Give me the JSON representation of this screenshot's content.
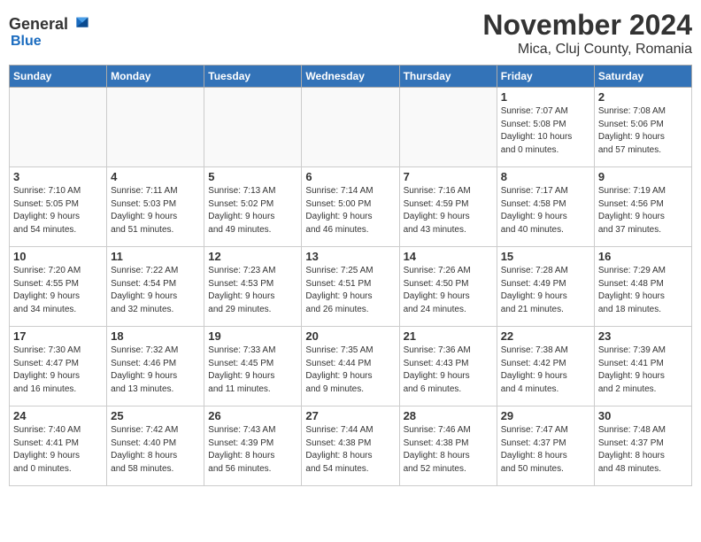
{
  "logo": {
    "general": "General",
    "blue": "Blue"
  },
  "title": "November 2024",
  "location": "Mica, Cluj County, Romania",
  "days_of_week": [
    "Sunday",
    "Monday",
    "Tuesday",
    "Wednesday",
    "Thursday",
    "Friday",
    "Saturday"
  ],
  "weeks": [
    [
      {
        "num": "",
        "info": "",
        "empty": true
      },
      {
        "num": "",
        "info": "",
        "empty": true
      },
      {
        "num": "",
        "info": "",
        "empty": true
      },
      {
        "num": "",
        "info": "",
        "empty": true
      },
      {
        "num": "",
        "info": "",
        "empty": true
      },
      {
        "num": "1",
        "info": "Sunrise: 7:07 AM\nSunset: 5:08 PM\nDaylight: 10 hours\nand 0 minutes.",
        "empty": false
      },
      {
        "num": "2",
        "info": "Sunrise: 7:08 AM\nSunset: 5:06 PM\nDaylight: 9 hours\nand 57 minutes.",
        "empty": false
      }
    ],
    [
      {
        "num": "3",
        "info": "Sunrise: 7:10 AM\nSunset: 5:05 PM\nDaylight: 9 hours\nand 54 minutes.",
        "empty": false
      },
      {
        "num": "4",
        "info": "Sunrise: 7:11 AM\nSunset: 5:03 PM\nDaylight: 9 hours\nand 51 minutes.",
        "empty": false
      },
      {
        "num": "5",
        "info": "Sunrise: 7:13 AM\nSunset: 5:02 PM\nDaylight: 9 hours\nand 49 minutes.",
        "empty": false
      },
      {
        "num": "6",
        "info": "Sunrise: 7:14 AM\nSunset: 5:00 PM\nDaylight: 9 hours\nand 46 minutes.",
        "empty": false
      },
      {
        "num": "7",
        "info": "Sunrise: 7:16 AM\nSunset: 4:59 PM\nDaylight: 9 hours\nand 43 minutes.",
        "empty": false
      },
      {
        "num": "8",
        "info": "Sunrise: 7:17 AM\nSunset: 4:58 PM\nDaylight: 9 hours\nand 40 minutes.",
        "empty": false
      },
      {
        "num": "9",
        "info": "Sunrise: 7:19 AM\nSunset: 4:56 PM\nDaylight: 9 hours\nand 37 minutes.",
        "empty": false
      }
    ],
    [
      {
        "num": "10",
        "info": "Sunrise: 7:20 AM\nSunset: 4:55 PM\nDaylight: 9 hours\nand 34 minutes.",
        "empty": false
      },
      {
        "num": "11",
        "info": "Sunrise: 7:22 AM\nSunset: 4:54 PM\nDaylight: 9 hours\nand 32 minutes.",
        "empty": false
      },
      {
        "num": "12",
        "info": "Sunrise: 7:23 AM\nSunset: 4:53 PM\nDaylight: 9 hours\nand 29 minutes.",
        "empty": false
      },
      {
        "num": "13",
        "info": "Sunrise: 7:25 AM\nSunset: 4:51 PM\nDaylight: 9 hours\nand 26 minutes.",
        "empty": false
      },
      {
        "num": "14",
        "info": "Sunrise: 7:26 AM\nSunset: 4:50 PM\nDaylight: 9 hours\nand 24 minutes.",
        "empty": false
      },
      {
        "num": "15",
        "info": "Sunrise: 7:28 AM\nSunset: 4:49 PM\nDaylight: 9 hours\nand 21 minutes.",
        "empty": false
      },
      {
        "num": "16",
        "info": "Sunrise: 7:29 AM\nSunset: 4:48 PM\nDaylight: 9 hours\nand 18 minutes.",
        "empty": false
      }
    ],
    [
      {
        "num": "17",
        "info": "Sunrise: 7:30 AM\nSunset: 4:47 PM\nDaylight: 9 hours\nand 16 minutes.",
        "empty": false
      },
      {
        "num": "18",
        "info": "Sunrise: 7:32 AM\nSunset: 4:46 PM\nDaylight: 9 hours\nand 13 minutes.",
        "empty": false
      },
      {
        "num": "19",
        "info": "Sunrise: 7:33 AM\nSunset: 4:45 PM\nDaylight: 9 hours\nand 11 minutes.",
        "empty": false
      },
      {
        "num": "20",
        "info": "Sunrise: 7:35 AM\nSunset: 4:44 PM\nDaylight: 9 hours\nand 9 minutes.",
        "empty": false
      },
      {
        "num": "21",
        "info": "Sunrise: 7:36 AM\nSunset: 4:43 PM\nDaylight: 9 hours\nand 6 minutes.",
        "empty": false
      },
      {
        "num": "22",
        "info": "Sunrise: 7:38 AM\nSunset: 4:42 PM\nDaylight: 9 hours\nand 4 minutes.",
        "empty": false
      },
      {
        "num": "23",
        "info": "Sunrise: 7:39 AM\nSunset: 4:41 PM\nDaylight: 9 hours\nand 2 minutes.",
        "empty": false
      }
    ],
    [
      {
        "num": "24",
        "info": "Sunrise: 7:40 AM\nSunset: 4:41 PM\nDaylight: 9 hours\nand 0 minutes.",
        "empty": false
      },
      {
        "num": "25",
        "info": "Sunrise: 7:42 AM\nSunset: 4:40 PM\nDaylight: 8 hours\nand 58 minutes.",
        "empty": false
      },
      {
        "num": "26",
        "info": "Sunrise: 7:43 AM\nSunset: 4:39 PM\nDaylight: 8 hours\nand 56 minutes.",
        "empty": false
      },
      {
        "num": "27",
        "info": "Sunrise: 7:44 AM\nSunset: 4:38 PM\nDaylight: 8 hours\nand 54 minutes.",
        "empty": false
      },
      {
        "num": "28",
        "info": "Sunrise: 7:46 AM\nSunset: 4:38 PM\nDaylight: 8 hours\nand 52 minutes.",
        "empty": false
      },
      {
        "num": "29",
        "info": "Sunrise: 7:47 AM\nSunset: 4:37 PM\nDaylight: 8 hours\nand 50 minutes.",
        "empty": false
      },
      {
        "num": "30",
        "info": "Sunrise: 7:48 AM\nSunset: 4:37 PM\nDaylight: 8 hours\nand 48 minutes.",
        "empty": false
      }
    ]
  ]
}
